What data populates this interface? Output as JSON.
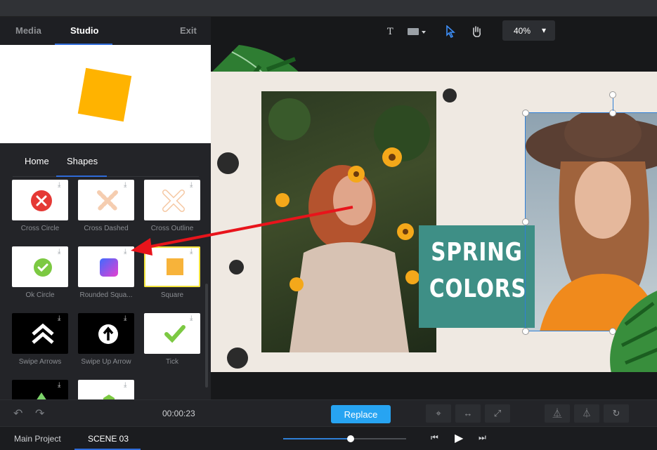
{
  "panel": {
    "tabs": [
      "Media",
      "Studio",
      "Exit"
    ],
    "subtabs": [
      "Home",
      "Shapes"
    ]
  },
  "shapes": [
    {
      "label": "Cross Circle"
    },
    {
      "label": "Cross Dashed"
    },
    {
      "label": "Cross Outline"
    },
    {
      "label": "Ok Circle"
    },
    {
      "label": "Rounded Squa..."
    },
    {
      "label": "Square"
    },
    {
      "label": "Swipe Arrows"
    },
    {
      "label": "Swipe Up Arrow"
    },
    {
      "label": "Tick"
    }
  ],
  "canvas": {
    "zoom": "40%",
    "poster_text_line1": "SPRING",
    "poster_text_line2": "COLORS"
  },
  "controls": {
    "time": "00:00:23",
    "replace_label": "Replace"
  },
  "timeline": {
    "tabs": [
      "Main Project",
      "SCENE 03"
    ],
    "progress": 0.55
  },
  "colors": {
    "accent": "#27a4f2",
    "preview_square": "#ffb300",
    "teal_box": "#3e8f86",
    "selection_outline": "#f2e33c",
    "arrow": "#e8141b"
  }
}
